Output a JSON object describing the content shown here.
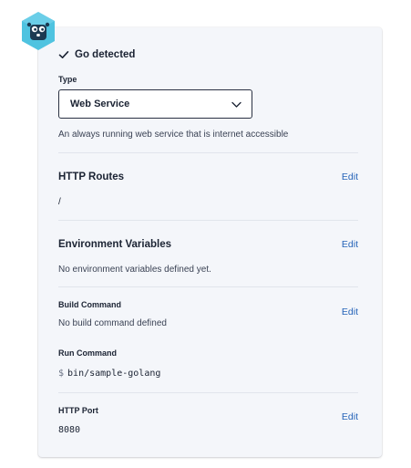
{
  "detected": {
    "label": "Go detected",
    "icon": "checkmark-icon"
  },
  "type": {
    "label": "Type",
    "selected": "Web Service",
    "description": "An always running web service that is internet accessible"
  },
  "http_routes": {
    "title": "HTTP Routes",
    "edit_label": "Edit",
    "value": "/"
  },
  "env_vars": {
    "title": "Environment Variables",
    "edit_label": "Edit",
    "value": "No environment variables defined yet."
  },
  "build": {
    "label": "Build Command",
    "edit_label": "Edit",
    "value": "No build command defined"
  },
  "run": {
    "label": "Run Command",
    "prompt": "$",
    "value": "bin/sample-golang"
  },
  "http_port": {
    "label": "HTTP Port",
    "edit_label": "Edit",
    "value": "8080"
  },
  "colors": {
    "card_bg": "#f4f6fa",
    "link": "#2563b8",
    "logo": "#4fc3e0",
    "text": "#1b2333"
  }
}
